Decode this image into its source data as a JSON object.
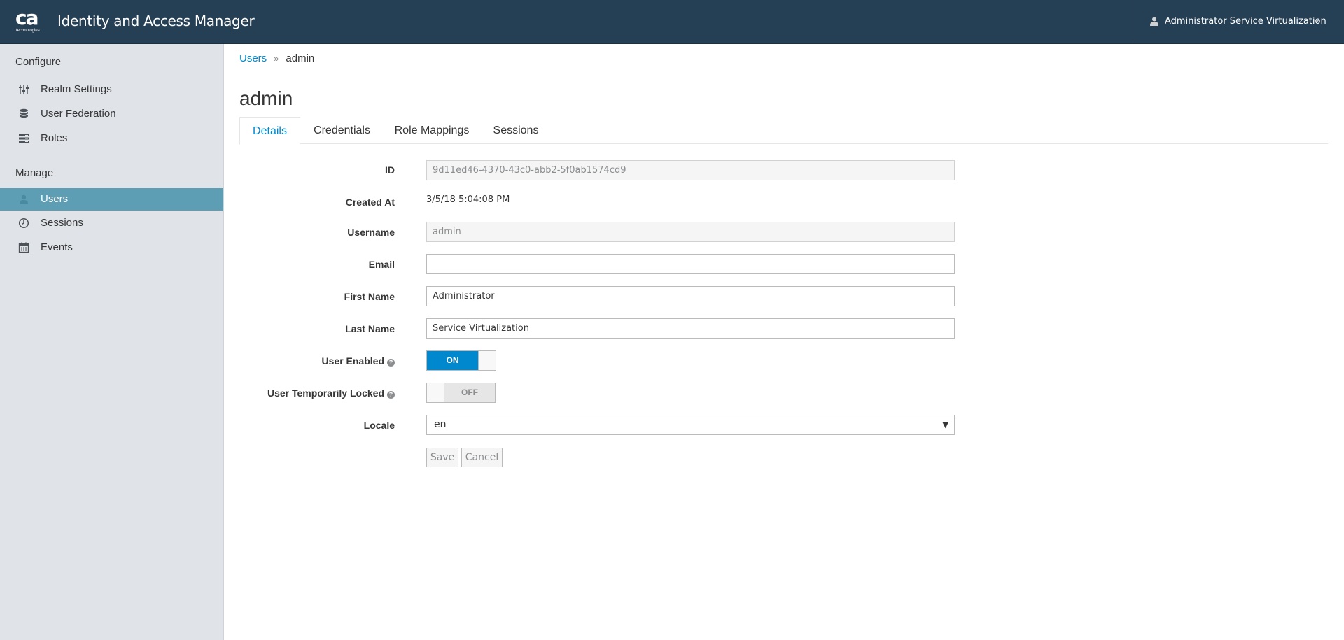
{
  "header": {
    "logo_text": "ca",
    "logo_subtext": "technologies",
    "app_title": "Identity and Access Manager",
    "user_name": "Administrator Service Virtualization",
    "bg_color": "#253f55"
  },
  "sidebar": {
    "configure_label": "Configure",
    "manage_label": "Manage",
    "configure_items": [
      {
        "label": "Realm Settings",
        "icon": "sliders-icon"
      },
      {
        "label": "User Federation",
        "icon": "database-icon"
      },
      {
        "label": "Roles",
        "icon": "list-icon"
      }
    ],
    "manage_items": [
      {
        "label": "Users",
        "icon": "user-icon",
        "active": true
      },
      {
        "label": "Sessions",
        "icon": "clock-icon"
      },
      {
        "label": "Events",
        "icon": "calendar-icon"
      }
    ],
    "active_color": "#5d9eb4"
  },
  "breadcrumb": {
    "parent": "Users",
    "separator": "»",
    "current": "admin"
  },
  "page_title": "admin",
  "tabs": [
    {
      "label": "Details",
      "active": true
    },
    {
      "label": "Credentials"
    },
    {
      "label": "Role Mappings"
    },
    {
      "label": "Sessions"
    }
  ],
  "form": {
    "id": {
      "label": "ID",
      "value": "9d11ed46-4370-43c0-abb2-5f0ab1574cd9"
    },
    "created_at": {
      "label": "Created At",
      "value": "3/5/18 5:04:08 PM"
    },
    "username": {
      "label": "Username",
      "value": "admin"
    },
    "email": {
      "label": "Email",
      "value": ""
    },
    "first_name": {
      "label": "First Name",
      "value": "Administrator"
    },
    "last_name": {
      "label": "Last Name",
      "value": "Service Virtualization"
    },
    "user_enabled": {
      "label": "User Enabled",
      "state": "ON",
      "help": "?"
    },
    "temp_locked": {
      "label": "User Temporarily Locked",
      "state": "OFF",
      "help": "?"
    },
    "locale": {
      "label": "Locale",
      "value": "en"
    },
    "save_label": "Save",
    "cancel_label": "Cancel"
  },
  "colors": {
    "link": "#0088ce",
    "switch_on": "#0088ce"
  }
}
